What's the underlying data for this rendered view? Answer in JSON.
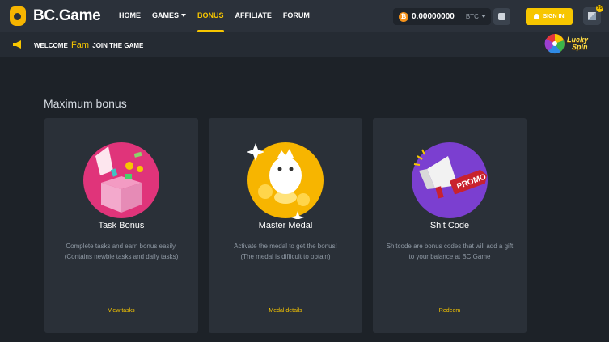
{
  "header": {
    "brand": "BC.Game",
    "nav": [
      {
        "label": "HOME",
        "dropdown": false,
        "active": false
      },
      {
        "label": "GAMES",
        "dropdown": true,
        "active": false
      },
      {
        "label": "BONUS",
        "dropdown": false,
        "active": true
      },
      {
        "label": "AFFILIATE",
        "dropdown": false,
        "active": false
      },
      {
        "label": "FORUM",
        "dropdown": false,
        "active": false
      }
    ],
    "wallet": {
      "coin_icon": "bitcoin-icon",
      "balance": "0.00000000",
      "currency": "BTC"
    },
    "sign_in": "SIGN IN",
    "chat_badge": "99"
  },
  "welcome": {
    "prefix": "WELCOME",
    "name": "Fam",
    "suffix": "JOIN THE GAME",
    "lucky_line1": "Lucky",
    "lucky_line2": "Spin"
  },
  "main": {
    "section_title": "Maximum bonus",
    "cards": [
      {
        "title": "Task Bonus",
        "desc_line1": "Complete tasks and earn bonus easily.",
        "desc_line2": "(Contains newbie tasks and daily tasks)",
        "link": "View tasks",
        "circle_color": "#e0347a"
      },
      {
        "title": "Master Medal",
        "desc_line1": "Activate the medal to get the bonus!",
        "desc_line2": "(The medal is difficult to obtain)",
        "link": "Medal details",
        "circle_color": "#f7b500"
      },
      {
        "title": "Shit Code",
        "desc_line1": "Shitcode are bonus codes that will add a gift",
        "desc_line2": "to your balance at BC.Game",
        "link": "Redeem",
        "circle_color": "#7b3fd0",
        "promo_tag": "PROMO"
      }
    ]
  },
  "colors": {
    "accent": "#f7c600",
    "background": "#1d2228",
    "card": "#2a3038"
  }
}
